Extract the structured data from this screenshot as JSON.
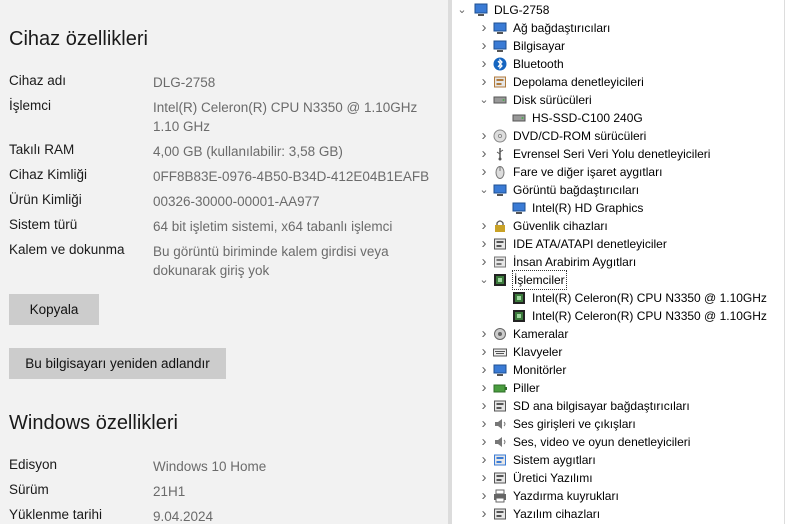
{
  "settings": {
    "device_title": "Cihaz özellikleri",
    "device_specs": [
      {
        "label": "Cihaz adı",
        "value": "DLG-2758"
      },
      {
        "label": "İşlemci",
        "value": "Intel(R) Celeron(R) CPU N3350 @ 1.10GHz   1.10 GHz"
      },
      {
        "label": "Takılı RAM",
        "value": "4,00 GB (kullanılabilir: 3,58 GB)"
      },
      {
        "label": "Cihaz Kimliği",
        "value": "0FF8B83E-0976-4B50-B34D-412E04B1EAFB"
      },
      {
        "label": "Ürün Kimliği",
        "value": "00326-30000-00001-AA977"
      },
      {
        "label": "Sistem türü",
        "value": "64 bit işletim sistemi, x64 tabanlı işlemci"
      },
      {
        "label": "Kalem ve dokunma",
        "value": "Bu görüntü biriminde kalem girdisi veya dokunarak giriş yok"
      }
    ],
    "copy_button": "Kopyala",
    "rename_button": "Bu bilgisayarı yeniden adlandır",
    "windows_title": "Windows özellikleri",
    "windows_specs": [
      {
        "label": "Edisyon",
        "value": "Windows 10 Home"
      },
      {
        "label": "Sürüm",
        "value": "21H1"
      },
      {
        "label": "Yüklenme tarihi",
        "value": "9.04.2024"
      }
    ]
  },
  "device_manager": {
    "root": "DLG-2758",
    "nodes": [
      {
        "label": "Ağ bağdaştırıcıları",
        "icon": "network-adapter-icon",
        "color": "#3a7bd5"
      },
      {
        "label": "Bilgisayar",
        "icon": "computer-icon",
        "color": "#3a7bd5"
      },
      {
        "label": "Bluetooth",
        "icon": "bluetooth-icon",
        "color": "#1565c0"
      },
      {
        "label": "Depolama denetleyicileri",
        "icon": "storage-controller-icon",
        "color": "#b07a3c"
      },
      {
        "label": "Disk sürücüleri",
        "icon": "disk-drive-icon",
        "color": "#555555",
        "expanded": true
      },
      {
        "label": "HS-SSD-C100 240G",
        "icon": "disk-icon",
        "color": "#555555",
        "child": true
      },
      {
        "label": "DVD/CD-ROM sürücüleri",
        "icon": "dvd-icon",
        "color": "#888888"
      },
      {
        "label": "Evrensel Seri Veri Yolu denetleyicileri",
        "icon": "usb-icon",
        "color": "#555555"
      },
      {
        "label": "Fare ve diğer işaret aygıtları",
        "icon": "mouse-icon",
        "color": "#777777"
      },
      {
        "label": "Görüntü bağdaştırıcıları",
        "icon": "display-adapter-icon",
        "color": "#3a7bd5",
        "expanded": true
      },
      {
        "label": "Intel(R) HD Graphics",
        "icon": "display-icon",
        "color": "#3a7bd5",
        "child": true
      },
      {
        "label": "Güvenlik cihazları",
        "icon": "security-device-icon",
        "color": "#c9a227"
      },
      {
        "label": "IDE ATA/ATAPI denetleyiciler",
        "icon": "ide-icon",
        "color": "#555555"
      },
      {
        "label": "İnsan Arabirim Aygıtları",
        "icon": "hid-icon",
        "color": "#777777"
      },
      {
        "label": "İşlemciler",
        "icon": "processor-icon",
        "color": "#3c7a3c",
        "expanded": true,
        "selected": true
      },
      {
        "label": "Intel(R) Celeron(R) CPU N3350 @ 1.10GHz",
        "icon": "cpu-icon",
        "color": "#3c7a3c",
        "child": true
      },
      {
        "label": "Intel(R) Celeron(R) CPU N3350 @ 1.10GHz",
        "icon": "cpu-icon",
        "color": "#3c7a3c",
        "child": true
      },
      {
        "label": "Kameralar",
        "icon": "camera-icon",
        "color": "#666666"
      },
      {
        "label": "Klavyeler",
        "icon": "keyboard-icon",
        "color": "#555555"
      },
      {
        "label": "Monitörler",
        "icon": "monitor-icon",
        "color": "#3a7bd5"
      },
      {
        "label": "Piller",
        "icon": "battery-icon",
        "color": "#4a9d3f"
      },
      {
        "label": "SD ana bilgisayar bağdaştırıcıları",
        "icon": "sd-host-icon",
        "color": "#555555"
      },
      {
        "label": "Ses girişleri ve çıkışları",
        "icon": "audio-io-icon",
        "color": "#777777"
      },
      {
        "label": "Ses, video ve oyun denetleyicileri",
        "icon": "sound-controller-icon",
        "color": "#777777"
      },
      {
        "label": "Sistem aygıtları",
        "icon": "system-device-icon",
        "color": "#3a7bd5"
      },
      {
        "label": "Üretici Yazılımı",
        "icon": "firmware-icon",
        "color": "#555555"
      },
      {
        "label": "Yazdırma kuyrukları",
        "icon": "print-queue-icon",
        "color": "#666666"
      },
      {
        "label": "Yazılım cihazları",
        "icon": "software-device-icon",
        "color": "#555555"
      }
    ]
  }
}
